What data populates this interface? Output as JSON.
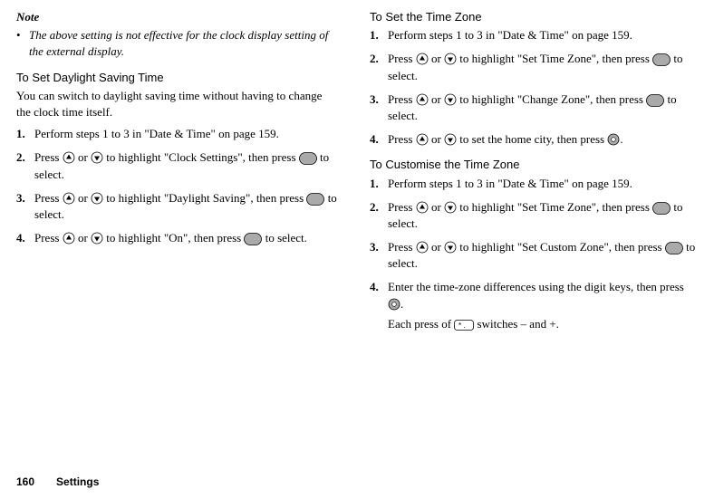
{
  "left": {
    "noteHeading": "Note",
    "noteBullet": "The above setting is not effective for the clock display setting of the external display.",
    "section1": {
      "heading": "To Set Daylight Saving Time",
      "intro": "You can switch to daylight saving time without having to change the clock time itself.",
      "steps": [
        {
          "num": "1.",
          "p1a": "Perform steps 1 to 3 in \"Date & Time\" on page 159."
        },
        {
          "num": "2.",
          "p1a": "Press ",
          "p1b": " or ",
          "p1c": " to highlight \"Clock Settings\", then press ",
          "p1d": " to select."
        },
        {
          "num": "3.",
          "p1a": "Press ",
          "p1b": " or ",
          "p1c": " to highlight \"Daylight Saving\", then press ",
          "p1d": " to select."
        },
        {
          "num": "4.",
          "p1a": "Press ",
          "p1b": " or ",
          "p1c": " to highlight \"On\", then press ",
          "p1d": " to select."
        }
      ]
    }
  },
  "right": {
    "section1": {
      "heading": "To Set the Time Zone",
      "steps": [
        {
          "num": "1.",
          "p1a": "Perform steps 1 to 3 in \"Date & Time\" on page 159."
        },
        {
          "num": "2.",
          "p1a": "Press ",
          "p1b": " or ",
          "p1c": " to highlight \"Set Time Zone\", then press ",
          "p1d": " to select."
        },
        {
          "num": "3.",
          "p1a": "Press ",
          "p1b": " or ",
          "p1c": " to highlight \"Change Zone\", then press ",
          "p1d": " to select."
        },
        {
          "num": "4.",
          "p1a": "Press ",
          "p1b": " or ",
          "p1c": " to set the home city, then press ",
          "p1d": "."
        }
      ]
    },
    "section2": {
      "heading": "To Customise the Time Zone",
      "steps": [
        {
          "num": "1.",
          "p1a": "Perform steps 1 to 3 in \"Date & Time\" on page 159."
        },
        {
          "num": "2.",
          "p1a": "Press ",
          "p1b": " or ",
          "p1c": " to highlight \"Set Time Zone\", then press ",
          "p1d": " to select."
        },
        {
          "num": "3.",
          "p1a": "Press ",
          "p1b": " or ",
          "p1c": " to highlight \"Set Custom Zone\", then press ",
          "p1d": " to select."
        },
        {
          "num": "4.",
          "p1a": "Enter the time-zone differences using the digit keys, then press ",
          "p1d": ".",
          "subA": "Each press of ",
          "subB": " switches – and +."
        }
      ]
    }
  },
  "footer": {
    "page": "160",
    "label": "Settings"
  }
}
